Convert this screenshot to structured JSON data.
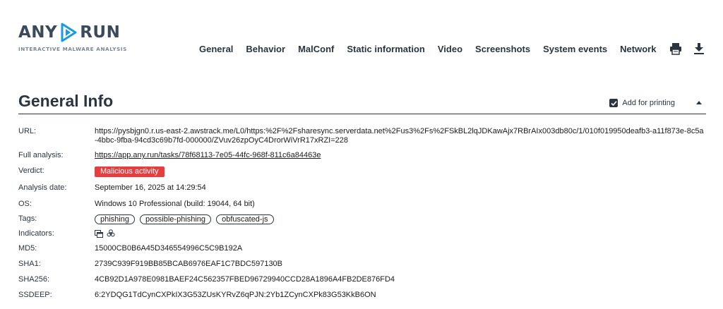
{
  "brand": {
    "left": "ANY",
    "right": "RUN",
    "tagline": "INTERACTIVE MALWARE ANALYSIS"
  },
  "nav": {
    "items": [
      {
        "id": "general",
        "label": "General"
      },
      {
        "id": "behavior",
        "label": "Behavior"
      },
      {
        "id": "malconf",
        "label": "MalConf"
      },
      {
        "id": "static",
        "label": "Static information"
      },
      {
        "id": "video",
        "label": "Video"
      },
      {
        "id": "screenshots",
        "label": "Screenshots"
      },
      {
        "id": "events",
        "label": "System events"
      },
      {
        "id": "network",
        "label": "Network"
      }
    ],
    "icons": [
      "printer-icon",
      "download-icon"
    ]
  },
  "general": {
    "title": "General Info",
    "print_label": "Add for printing",
    "print_checked": true,
    "rows": {
      "url": {
        "label": "URL:",
        "value": "https://pysbjgn0.r.us-east-2.awstrack.me/L0/https:%2F%2Fsharesync.serverdata.net%2Fus3%2Fs%2FSkBL2lqJDKawAjx7RBrAIx003db80c/1/010f019950deafb3-a11f873e-8c5a-4bbc-9fba-94cd3c69b7fd-000000/ZVuv26zpOyC4DrorWiVrR17xRZI=228"
      },
      "full": {
        "label": "Full analysis:",
        "value": "https://app.any.run/tasks/78f68113-7e05-44fc-968f-811c6a84463e"
      },
      "verdict": {
        "label": "Verdict:",
        "value": "Malicious activity",
        "color": "#e53e3e"
      },
      "date": {
        "label": "Analysis date:",
        "value": "September 16, 2025 at 14:29:54"
      },
      "os": {
        "label": "OS:",
        "value": "Windows 10 Professional (build: 19044, 64 bit)"
      },
      "tags": {
        "label": "Tags:",
        "values": [
          "phishing",
          "possible-phishing",
          "obfuscated-js"
        ]
      },
      "indicators": {
        "label": "Indicators:",
        "icons": [
          "window-icon",
          "biohazard-icon"
        ]
      },
      "md5": {
        "label": "MD5:",
        "value": "15000CB0B6A45D346554996C5C9B192A"
      },
      "sha1": {
        "label": "SHA1:",
        "value": "2739C939F919BB85BCAB6976EAF1C7BDC597130B"
      },
      "sha256": {
        "label": "SHA256:",
        "value": "4CB92D1A978E0981BAEF24C562357FBED96729940CCD28A1896A4FB2DE876FD4"
      },
      "ssdeep": {
        "label": "SSDEEP:",
        "value": "6:2YDQG1TdCynCXPkIX3G53ZUsKYRvZ6qPJN:2Yb1ZCynCXPk83G53KkB6ON"
      }
    }
  },
  "colors": {
    "text": "#2b3440",
    "accent": "#e53e3e"
  }
}
